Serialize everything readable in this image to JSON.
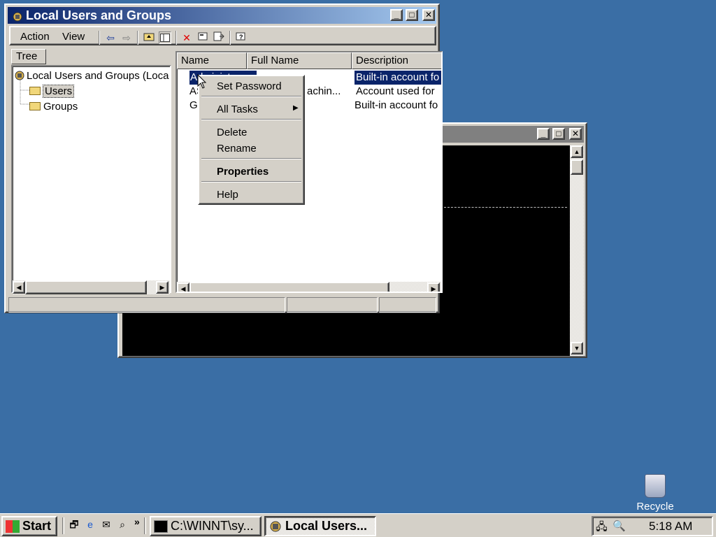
{
  "desktop": {
    "background": "#3a6ea5",
    "recycle_label": "Recycle"
  },
  "console_window": {
    "buttons": [
      "minimize-icon",
      "maximize-icon",
      "close-icon"
    ]
  },
  "mmc": {
    "title": "Local Users and Groups",
    "menu": {
      "action": "Action",
      "view": "View"
    },
    "toolbar_icons": [
      "back-icon",
      "forward-icon",
      "up-folder-icon",
      "show-tree-icon",
      "delete-icon",
      "properties-icon",
      "export-icon",
      "help-icon"
    ],
    "tree_tab": "Tree",
    "tree": {
      "root": "Local Users and Groups (Loca",
      "items": [
        "Users",
        "Groups"
      ]
    },
    "columns": [
      "Name",
      "Full Name",
      "Description"
    ],
    "rows": [
      {
        "name": "Administ...",
        "full_name": "",
        "description": "Built-in account fo",
        "selected": true
      },
      {
        "name": "AS",
        "full_name": "achin...",
        "description": "Account used for",
        "selected": false
      },
      {
        "name": "Gu",
        "full_name": "",
        "description": "Built-in account fo",
        "selected": false
      }
    ]
  },
  "context_menu": {
    "set_password": "Set Password",
    "all_tasks": "All Tasks",
    "delete": "Delete",
    "rename": "Rename",
    "properties": "Properties",
    "help": "Help"
  },
  "taskbar": {
    "start": "Start",
    "overflow": "»",
    "tasks": [
      {
        "label": "C:\\WINNT\\sy...",
        "active": false
      },
      {
        "label": "Local Users...",
        "active": true
      }
    ],
    "clock": "5:18 AM"
  },
  "colors": {
    "selection": "#0a246a",
    "titlebar_active": "#0a246a",
    "face": "#d4d0c8"
  }
}
